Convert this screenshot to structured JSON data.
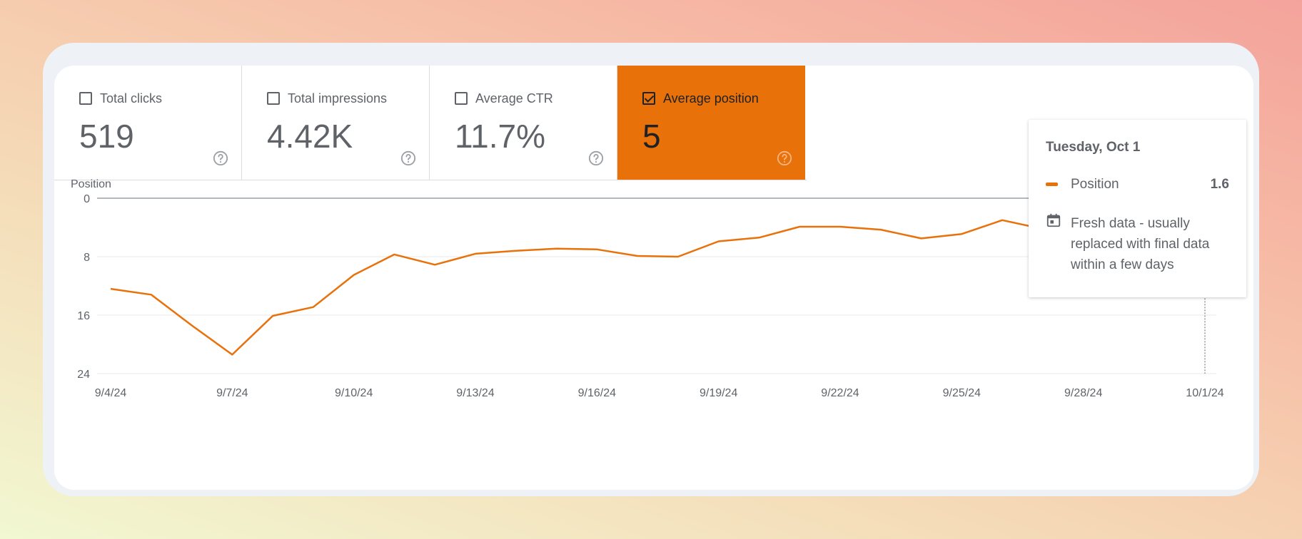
{
  "metrics": [
    {
      "label": "Total clicks",
      "value": "519",
      "checked": false
    },
    {
      "label": "Total impressions",
      "value": "4.42K",
      "checked": false
    },
    {
      "label": "Average CTR",
      "value": "11.7%",
      "checked": false
    },
    {
      "label": "Average position",
      "value": "5",
      "checked": true
    }
  ],
  "colors": {
    "accent": "#e8710a",
    "grid": "#e8eaed",
    "text": "#5f6368"
  },
  "icons": {
    "help": "help-circle-icon",
    "checkbox": "checkbox-icon",
    "calendar": "calendar-icon"
  },
  "tooltip": {
    "date": "Tuesday, Oct 1",
    "series": "Position",
    "value": "1.6",
    "note": "Fresh data - usually replaced with final data within a few days"
  },
  "chart_data": {
    "type": "line",
    "ylabel": "Position",
    "y_reversed": true,
    "ylim": [
      0,
      24
    ],
    "yticks": [
      "0",
      "8",
      "16",
      "24"
    ],
    "xticks": [
      "9/4/24",
      "9/7/24",
      "9/10/24",
      "9/13/24",
      "9/16/24",
      "9/19/24",
      "9/22/24",
      "9/25/24",
      "9/28/24",
      "10/1/24"
    ],
    "series": [
      {
        "x": [
          "9/4/24",
          "9/5/24",
          "9/6/24",
          "9/7/24",
          "9/8/24",
          "9/9/24",
          "9/10/24",
          "9/11/24",
          "9/12/24",
          "9/13/24",
          "9/14/24",
          "9/15/24",
          "9/16/24",
          "9/17/24",
          "9/18/24",
          "9/19/24",
          "9/20/24",
          "9/21/24",
          "9/22/24",
          "9/23/24",
          "9/24/24",
          "9/25/24",
          "9/26/24",
          "9/27/24",
          "9/28/24",
          "9/29/24",
          "9/30/24",
          "10/1/24"
        ],
        "values": [
          12.4,
          13.2,
          17.4,
          21.4,
          16.1,
          14.9,
          10.5,
          7.7,
          9.1,
          7.6,
          7.2,
          6.9,
          7.0,
          7.9,
          8.0,
          5.9,
          5.4,
          3.9,
          3.9,
          4.3,
          5.5,
          4.9,
          3.0,
          4.2,
          2.0,
          2.9,
          2.0,
          1.6
        ]
      }
    ],
    "grid": true,
    "highlight_index": 27
  }
}
